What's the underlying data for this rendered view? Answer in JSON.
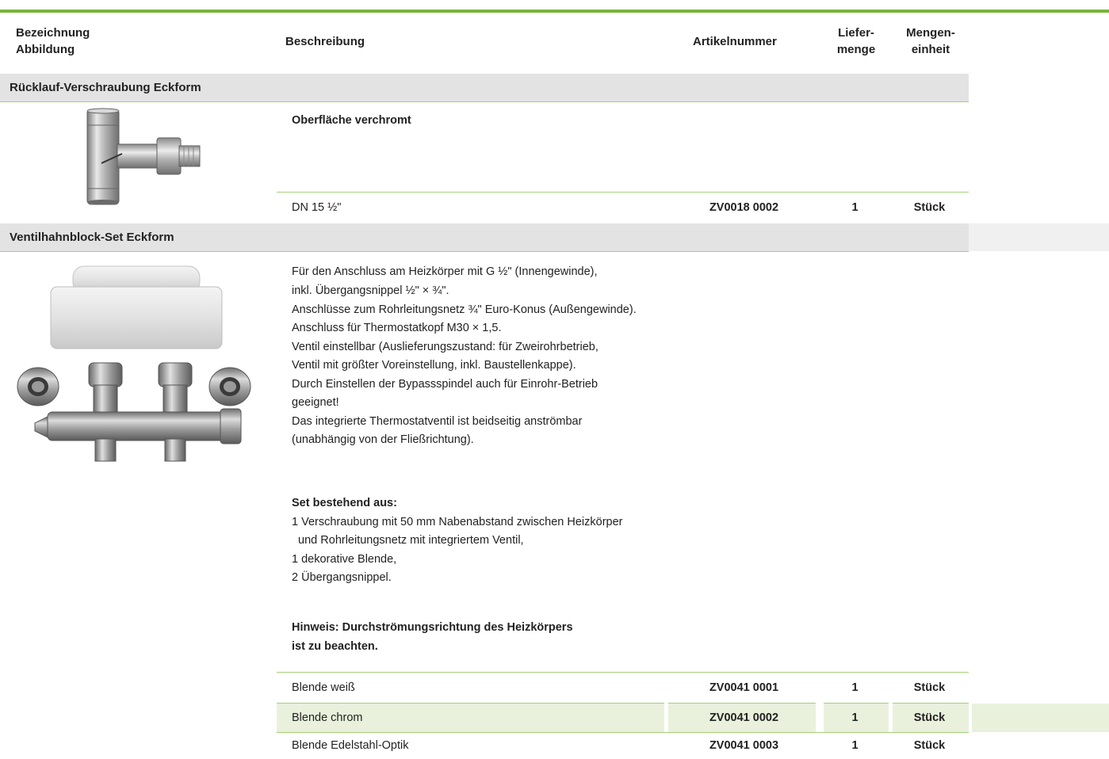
{
  "header": {
    "col_name_line1": "Bezeichnung",
    "col_name_line2": "Abbildung",
    "col_desc": "Beschreibung",
    "col_article": "Artikelnummer",
    "col_qty_line1": "Liefer-",
    "col_qty_line2": "menge",
    "col_unit_line1": "Mengen-",
    "col_unit_line2": "einheit"
  },
  "sections": [
    {
      "title": "Rücklauf-Verschraubung Eckform",
      "image_icon": "angle-return-fitting-photo",
      "desc_heading": "Oberfläche verchromt",
      "rows": [
        {
          "desc": "DN 15 ½\"",
          "article": "ZV0018 0002",
          "qty": "1",
          "unit": "Stück"
        }
      ]
    },
    {
      "title": "Ventilhahnblock-Set Eckform",
      "image_icon": "valve-block-set-photo",
      "desc_lines": [
        "Für den Anschluss am Heizkörper mit G ½\" (Innengewinde),",
        "inkl. Übergangsnippel ½\" × ¾\".",
        "Anschlüsse zum Rohrleitungsnetz ¾\" Euro-Konus (Außengewinde).",
        "Anschluss für Thermostatkopf M30 × 1,5.",
        "Ventil einstellbar (Auslieferungszustand: für Zweirohrbetrieb,",
        "Ventil mit größter Voreinstellung, inkl. Baustellenkappe).",
        "Durch Einstellen der Bypassspindel auch für Einrohr-Betrieb",
        "geeignet!",
        "Das integrierte Thermostatventil ist beidseitig anströmbar",
        "(unabhängig von der Fließrichtung)."
      ],
      "set_heading": "Set bestehend aus:",
      "set_lines": [
        "1 Verschraubung mit 50 mm Nabenabstand zwischen Heizkörper",
        "  und Rohrleitungsnetz mit integriertem Ventil,",
        "1 dekorative Blende,",
        "2 Übergangsnippel."
      ],
      "note_lines": [
        "Hinweis: Durchströmungsrichtung des Heizkörpers",
        "ist zu beachten."
      ],
      "rows": [
        {
          "desc": "Blende weiß",
          "article": "ZV0041 0001",
          "qty": "1",
          "unit": "Stück"
        },
        {
          "desc": "Blende chrom",
          "article": "ZV0041 0002",
          "qty": "1",
          "unit": "Stück"
        },
        {
          "desc": "Blende Edelstahl-Optik",
          "article": "ZV0041 0003",
          "qty": "1",
          "unit": "Stück"
        }
      ]
    }
  ],
  "colors": {
    "accent_green": "#7ab33a",
    "line_green": "#a6cf7a",
    "row_band_green": "#e9f1dc",
    "section_gray": "#e3e3e3"
  }
}
